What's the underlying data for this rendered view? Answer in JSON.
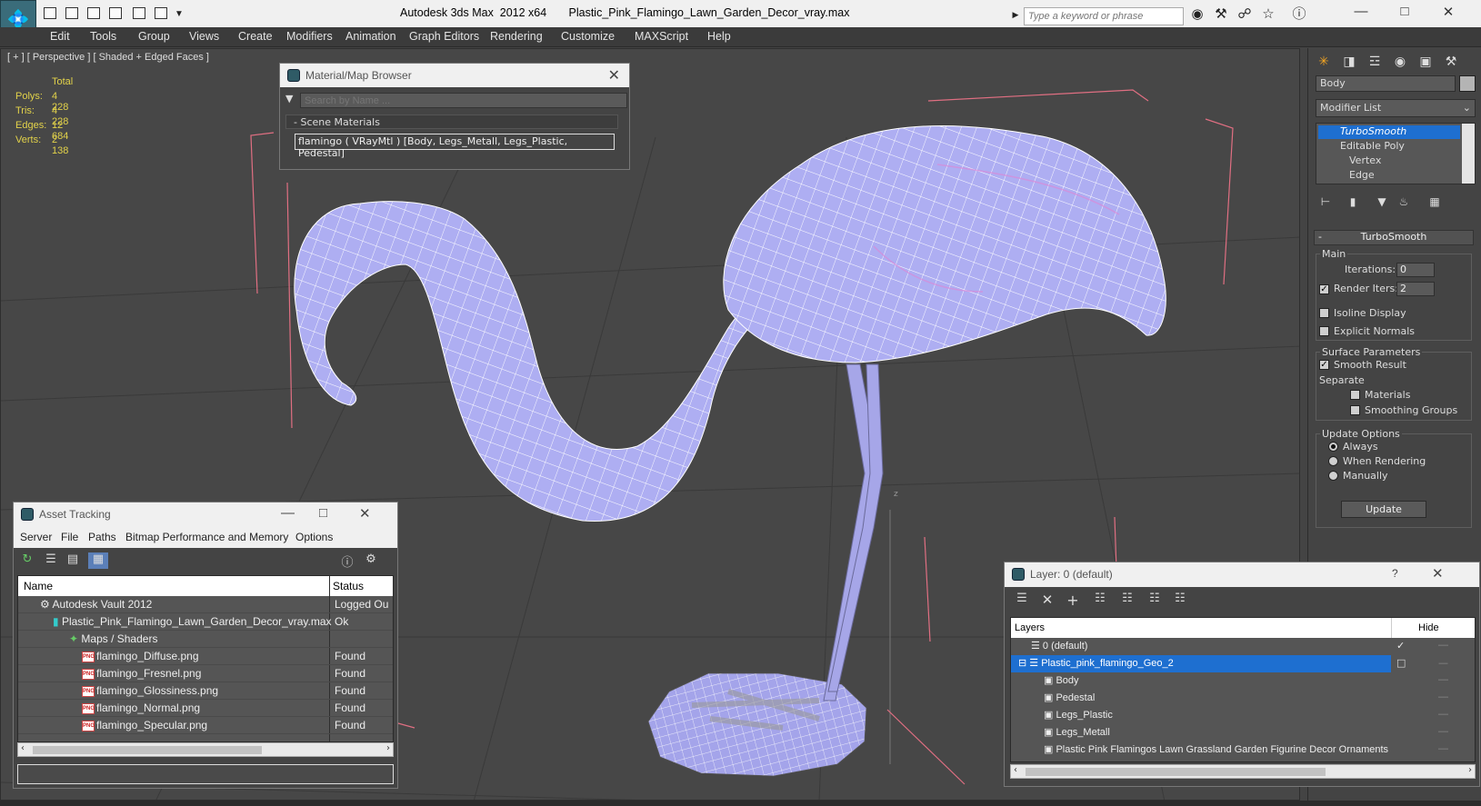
{
  "titlebar": {
    "title": "Autodesk 3ds Max  2012 x64       Plastic_Pink_Flamingo_Lawn_Garden_Decor_vray.max",
    "search_placeholder": "Type a keyword or phrase",
    "icons": [
      "binoculars-icon",
      "tools-icon",
      "star-icon",
      "help-icon"
    ]
  },
  "menu": [
    "Edit",
    "Tools",
    "Group",
    "Views",
    "Create",
    "Modifiers",
    "Animation",
    "Graph Editors",
    "Rendering",
    "Customize",
    "MAXScript",
    "Help"
  ],
  "viewport": {
    "label": "[ + ] [ Perspective ] [ Shaded + Edged Faces ]",
    "stats_header": "Total",
    "stats": [
      {
        "label": "Polys:",
        "value": "4 228"
      },
      {
        "label": "Tris:",
        "value": "4 228"
      },
      {
        "label": "Edges:",
        "value": "12 684"
      },
      {
        "label": "Verts:",
        "value": "2 138"
      }
    ],
    "mesh_color": "#b0b0f0",
    "bbox_color": "#e0607a",
    "axis_label": "z"
  },
  "material_browser": {
    "title": "Material/Map Browser",
    "search_placeholder": "Search by Name ...",
    "section": "Scene Materials",
    "item": "flamingo  ( VRayMtl ) [Body, Legs_Metall, Legs_Plastic, Pedestal]"
  },
  "command_panel": {
    "object_name": "Body",
    "modifier_list": "Modifier List",
    "stack": [
      "TurboSmooth",
      "Editable Poly",
      "Vertex",
      "Edge"
    ],
    "rollout": "TurboSmooth",
    "main": "Main",
    "iterations_label": "Iterations:",
    "iterations_value": "0",
    "render_iters_label": "Render Iters:",
    "render_iters_value": "2",
    "isoline": "Isoline Display",
    "explicit_normals": "Explicit Normals",
    "surface_params": "Surface Parameters",
    "smooth_result": "Smooth Result",
    "separate": "Separate",
    "materials": "Materials",
    "smoothing_groups": "Smoothing Groups",
    "update_options": "Update Options",
    "always": "Always",
    "when_rendering": "When Rendering",
    "manually": "Manually",
    "update": "Update"
  },
  "asset_tracking": {
    "title": "Asset Tracking",
    "menu": [
      "Server",
      "File",
      "Paths",
      "Bitmap Performance and Memory",
      "Options"
    ],
    "col_name": "Name",
    "col_status": "Status",
    "rows": [
      {
        "name": "Autodesk Vault 2012",
        "status": "Logged Ou",
        "indent": 1,
        "icon": "vault"
      },
      {
        "name": "Plastic_Pink_Flamingo_Lawn_Garden_Decor_vray.max",
        "status": "Ok",
        "indent": 2,
        "icon": "max"
      },
      {
        "name": "Maps / Shaders",
        "status": "",
        "indent": 3,
        "icon": "maps"
      },
      {
        "name": "flamingo_Diffuse.png",
        "status": "Found",
        "indent": 4,
        "icon": "png"
      },
      {
        "name": "flamingo_Fresnel.png",
        "status": "Found",
        "indent": 4,
        "icon": "png"
      },
      {
        "name": "flamingo_Glossiness.png",
        "status": "Found",
        "indent": 4,
        "icon": "png"
      },
      {
        "name": "flamingo_Normal.png",
        "status": "Found",
        "indent": 4,
        "icon": "png"
      },
      {
        "name": "flamingo_Specular.png",
        "status": "Found",
        "indent": 4,
        "icon": "png"
      }
    ],
    "png_badge": "PNG"
  },
  "layers": {
    "title": "Layer: 0 (default)",
    "help": "?",
    "col_layers": "Layers",
    "col_hide": "Hide",
    "rows": [
      {
        "name": "0 (default)",
        "indent": 0,
        "selected": false
      },
      {
        "name": "Plastic_pink_flamingo_Geo_2",
        "indent": 0,
        "selected": true
      },
      {
        "name": "Body",
        "indent": 1,
        "selected": false
      },
      {
        "name": "Pedestal",
        "indent": 1,
        "selected": false
      },
      {
        "name": "Legs_Plastic",
        "indent": 1,
        "selected": false
      },
      {
        "name": "Legs_Metall",
        "indent": 1,
        "selected": false
      },
      {
        "name": "Plastic Pink Flamingos Lawn Grassland Garden Figurine Decor Ornaments",
        "indent": 1,
        "selected": false
      }
    ]
  }
}
